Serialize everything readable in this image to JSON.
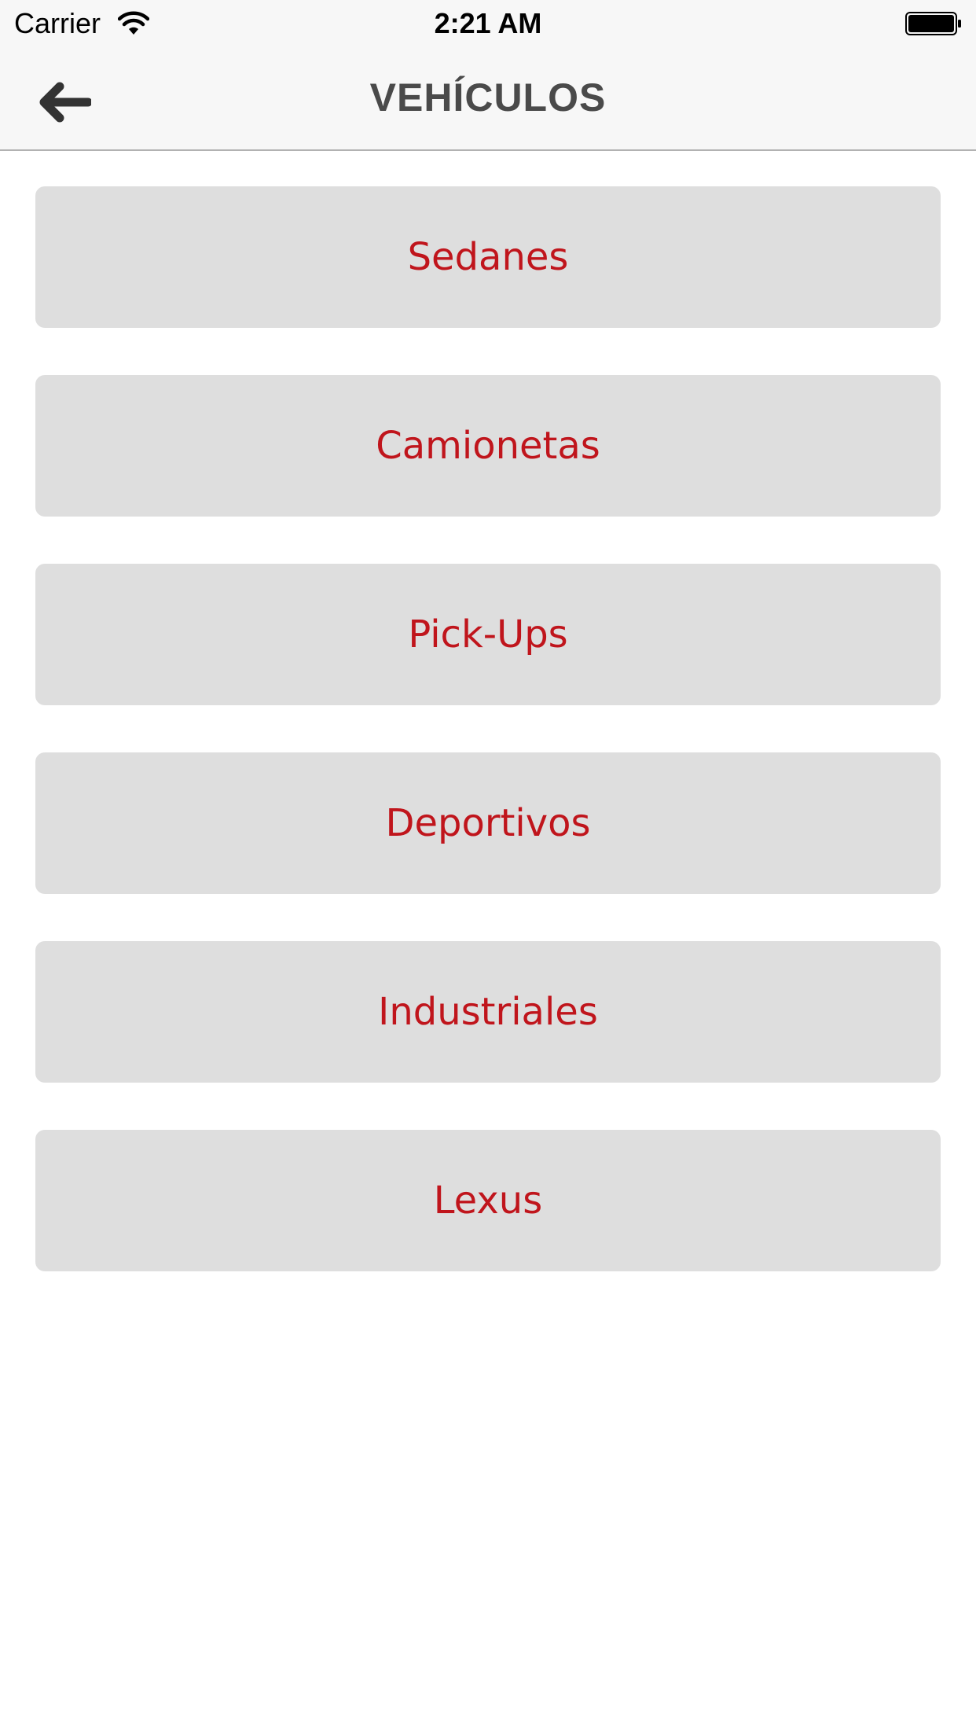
{
  "status_bar": {
    "carrier": "Carrier",
    "time": "2:21 AM",
    "wifi_icon": "wifi-icon",
    "battery_icon": "battery-icon"
  },
  "nav": {
    "title": "VEHÍCULOS",
    "back_icon": "arrow-left-icon"
  },
  "categories": [
    {
      "label": "Sedanes"
    },
    {
      "label": "Camionetas"
    },
    {
      "label": "Pick-Ups"
    },
    {
      "label": "Deportivos"
    },
    {
      "label": "Industriales"
    },
    {
      "label": "Lexus"
    }
  ],
  "colors": {
    "accent_text": "#c0151c",
    "button_bg": "#dedede",
    "bar_bg": "#f7f7f7",
    "title_text": "#4a4a4a"
  }
}
